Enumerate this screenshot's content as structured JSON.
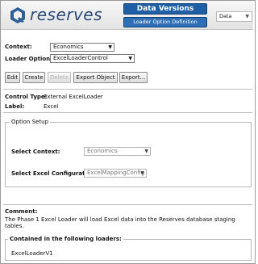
{
  "header": {
    "logo_text": "reserves",
    "app_title": "Data Versions",
    "page_title": "Loader Option Definition",
    "data_select": "Data"
  },
  "form": {
    "context_label": "Context:",
    "context_value": "Economics",
    "loader_options_label": "Loader Options:",
    "loader_options_value": "ExcelLoaderControl"
  },
  "toolbar": {
    "edit": "Edit",
    "create": "Create",
    "delete": "Delete",
    "export_object": "Export Object",
    "export_more": "Export..."
  },
  "details": {
    "control_type_label": "Control Type:",
    "control_type_value": "External ExcelLoader",
    "label_label": "Label:",
    "label_value": "Excel"
  },
  "option_setup": {
    "legend": "Option Setup",
    "select_context_label": "Select Context:",
    "select_context_value": "Economics",
    "select_excel_label": "Select Excel Configuration:",
    "select_excel_value": "ExcelMappingConfig"
  },
  "comment": {
    "label": "Comment:",
    "text": "The Phase 1 Excel Loader will load Excel data into the Reserves database staging tables."
  },
  "loaders": {
    "legend": "Contained in the following loaders:",
    "items": [
      "ExcelLoaderV1"
    ]
  }
}
